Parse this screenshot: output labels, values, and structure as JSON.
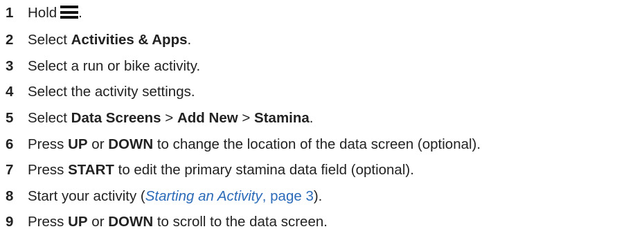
{
  "steps": [
    {
      "num": "1",
      "pre": "Hold",
      "icon": "menu-icon",
      "post": "."
    },
    {
      "num": "2",
      "pre": "Select ",
      "b1": "Activities & Apps",
      "post": "."
    },
    {
      "num": "3",
      "text": "Select a run or bike activity."
    },
    {
      "num": "4",
      "text": "Select the activity settings."
    },
    {
      "num": "5",
      "pre": "Select ",
      "b1": "Data Screens",
      "sep1": " > ",
      "b2": "Add New",
      "sep2": " > ",
      "b3": "Stamina",
      "post": "."
    },
    {
      "num": "6",
      "pre": "Press ",
      "b1": "UP",
      "mid": " or ",
      "b2": "DOWN",
      "post": " to change the location of the data screen (optional)."
    },
    {
      "num": "7",
      "pre": "Press ",
      "b1": "START",
      "post": " to edit the primary stamina data field (optional)."
    },
    {
      "num": "8",
      "pre": "Start your activity (",
      "link_title": "Starting an Activity",
      "link_page": ", page 3",
      "post": ")."
    },
    {
      "num": "9",
      "pre": "Press ",
      "b1": "UP",
      "mid": " or ",
      "b2": "DOWN",
      "post": " to scroll to the data screen."
    }
  ]
}
